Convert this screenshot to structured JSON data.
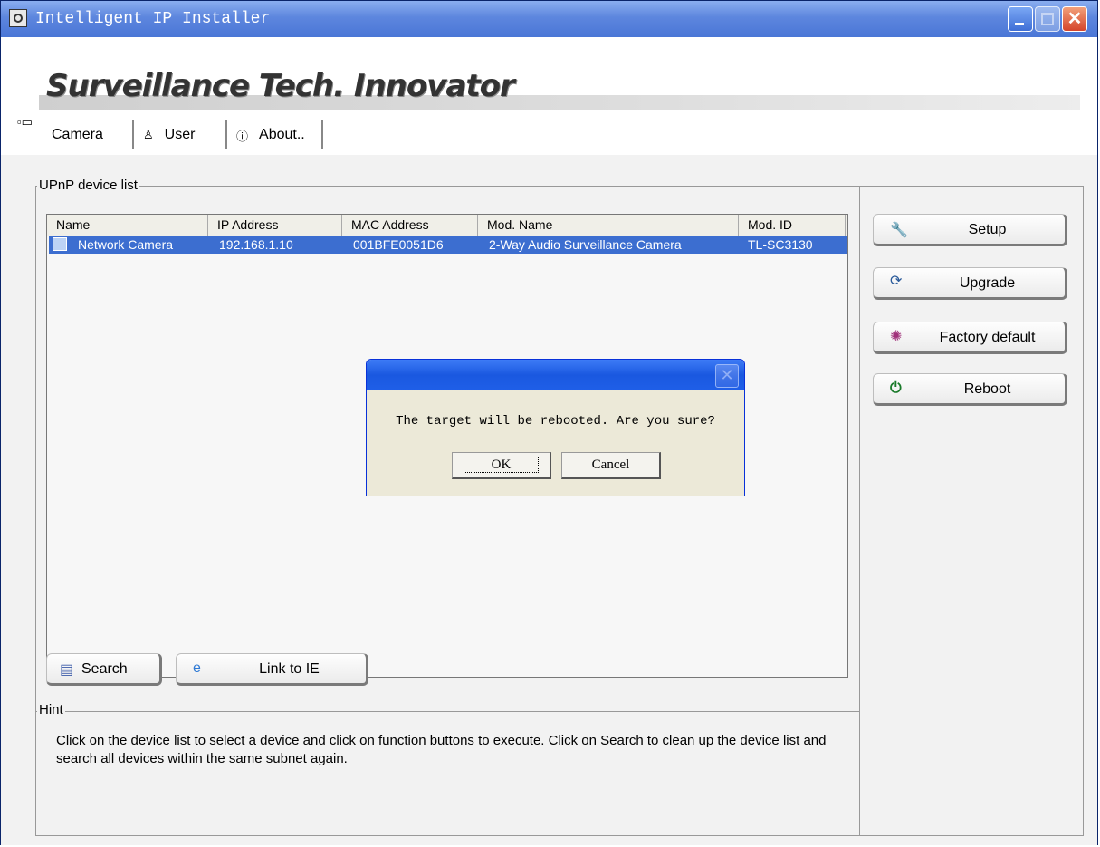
{
  "window": {
    "title": "Intelligent IP Installer"
  },
  "banner": {
    "slogan": "Surveillance Tech. Innovator"
  },
  "tabs": [
    {
      "label": "Camera",
      "icon": "camera-icon"
    },
    {
      "label": "User",
      "icon": "user-icon"
    },
    {
      "label": "About..",
      "icon": "info-icon"
    }
  ],
  "device_list": {
    "legend": "UPnP device list",
    "columns": [
      "Name",
      "IP Address",
      "MAC Address",
      "Mod. Name",
      "Mod. ID"
    ],
    "rows": [
      {
        "name": "Network Camera",
        "ip": "192.168.1.10",
        "mac": "001BFE0051D6",
        "mod_name": "2-Way Audio Surveillance Camera",
        "mod_id": "TL-SC3130",
        "selected": true
      }
    ]
  },
  "actions": {
    "setup": "Setup",
    "upgrade": "Upgrade",
    "factory_default": "Factory default",
    "reboot": "Reboot",
    "search": "Search",
    "link_ie": "Link to IE"
  },
  "hint": {
    "legend": "Hint",
    "text": "Click on the device list to select a device and click on function buttons to execute. Click on Search to clean up the device list and search all devices  within the same subnet again."
  },
  "dialog": {
    "message": "The target will be rebooted. Are you sure?",
    "ok": "OK",
    "cancel": "Cancel"
  },
  "colors": {
    "selection": "#3c6ed0",
    "titlebar": "#4a76d6"
  }
}
